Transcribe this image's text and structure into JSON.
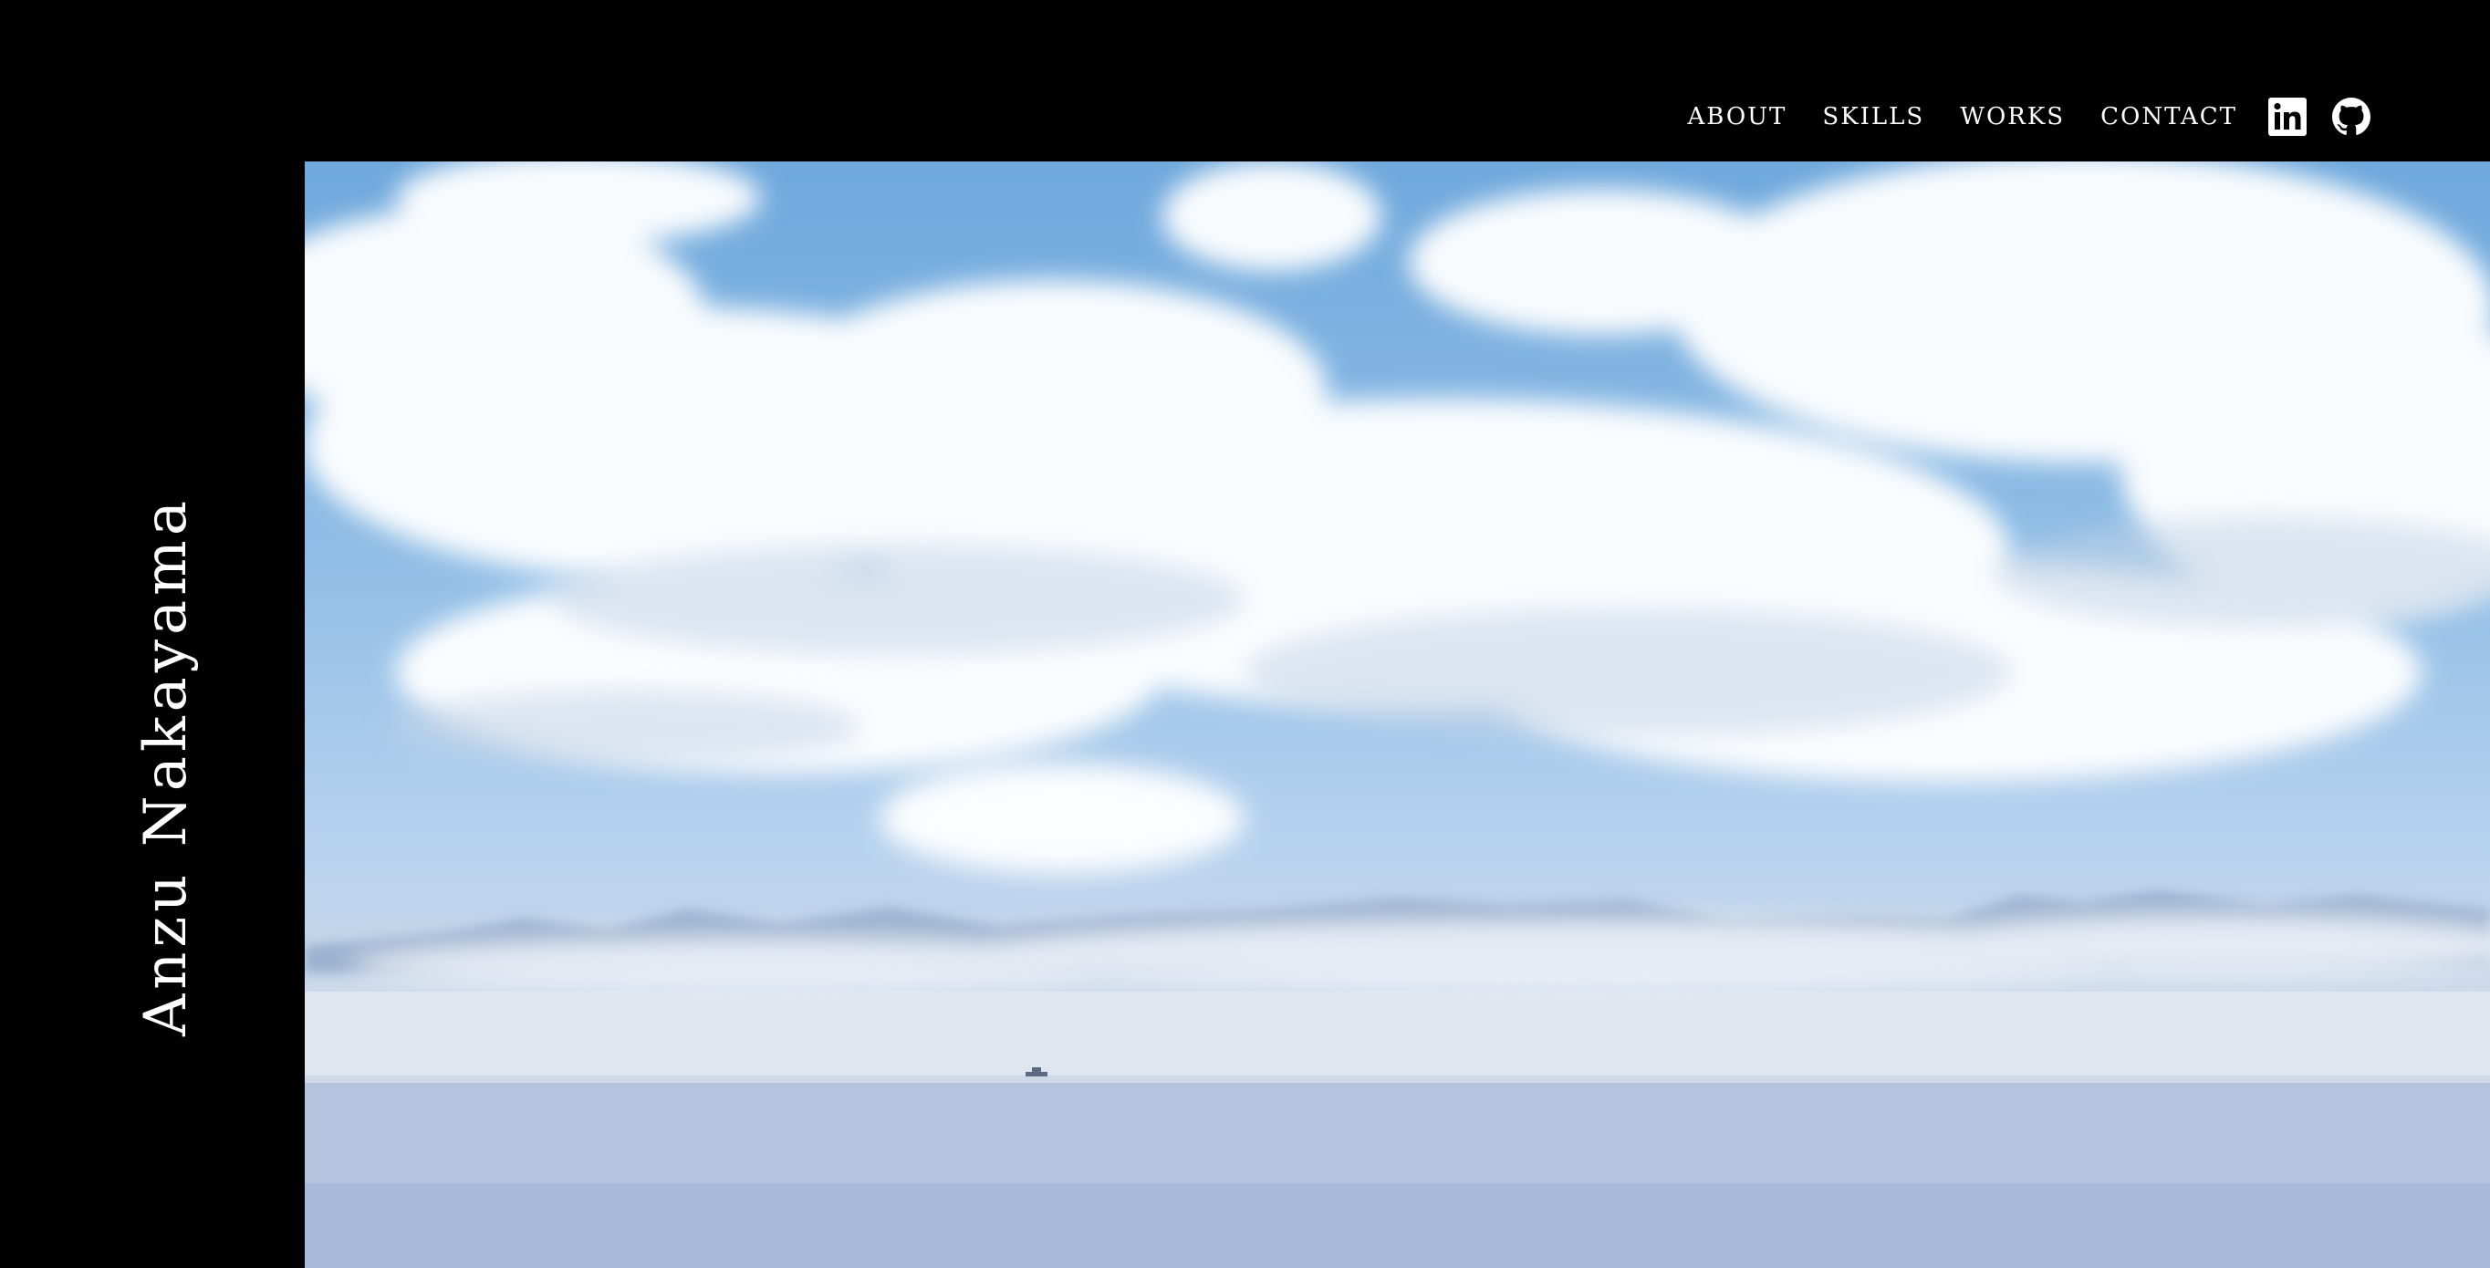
{
  "nav": {
    "links": [
      {
        "label": "ABOUT"
      },
      {
        "label": "SKILLS"
      },
      {
        "label": "WORKS"
      },
      {
        "label": "CONTACT"
      }
    ],
    "social": [
      {
        "icon": "linkedin-icon"
      },
      {
        "icon": "github-icon"
      }
    ]
  },
  "sidebar": {
    "name": "Anzu Nakayama"
  },
  "hero": {
    "image": "sky-clouds-sea-photo"
  },
  "colors": {
    "background": "#000000",
    "text": "#ffffff",
    "sky": "#7fb1df",
    "sea": "#aebfdb"
  }
}
